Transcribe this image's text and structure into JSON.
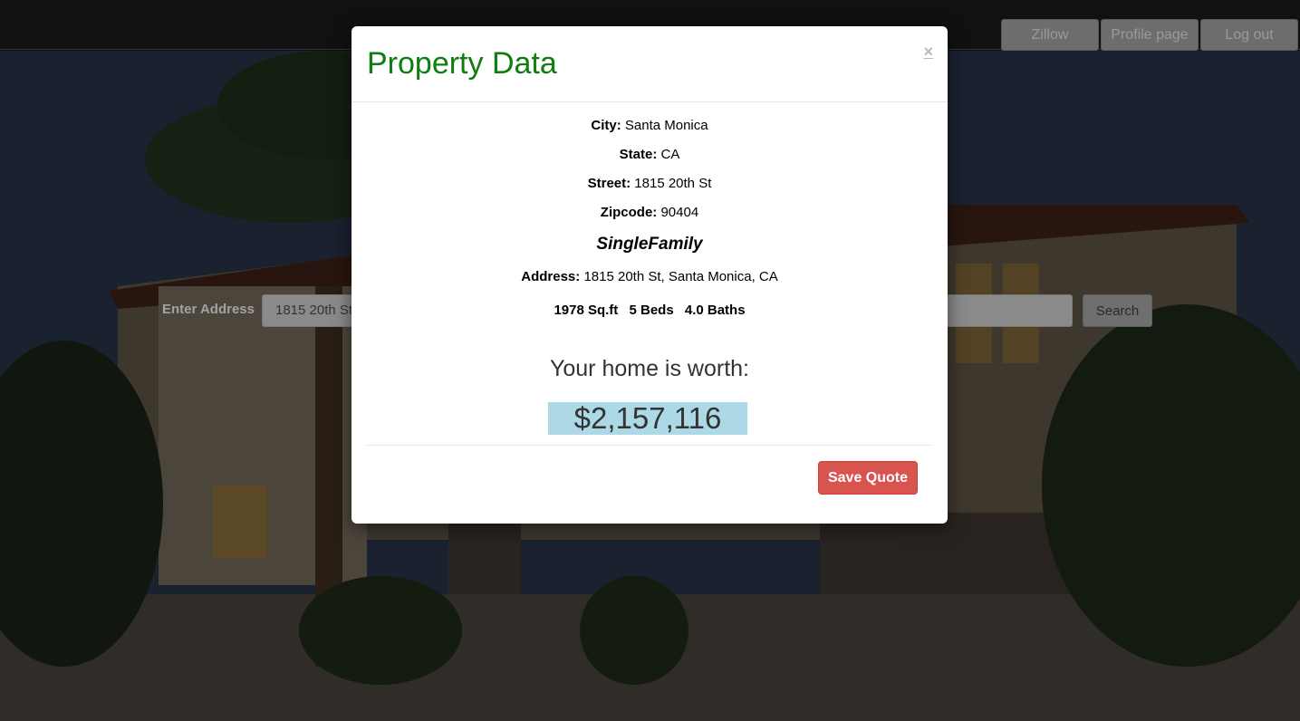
{
  "nav": {
    "zillow_label": "Zillow",
    "profile_label": "Profile page",
    "logout_label": "Log out"
  },
  "search": {
    "label": "Enter Address",
    "value": "1815 20th St",
    "button_label": "Search"
  },
  "modal": {
    "title": "Property Data",
    "close_label": "×",
    "city_label": "City:",
    "city": "Santa Monica",
    "state_label": "State:",
    "state": "CA",
    "street_label": "Street:",
    "street": "1815 20th St",
    "zipcode_label": "Zipcode:",
    "zipcode": "90404",
    "home_type": "SingleFamily",
    "address_label": "Address:",
    "address": "1815 20th St, Santa Monica, CA",
    "sqft": "1978 Sq.ft",
    "beds": "5 Beds",
    "baths": "4.0 Baths",
    "worth_label": "Your home is worth:",
    "worth_value": "$2,157,116",
    "save_label": "Save Quote"
  },
  "colors": {
    "title_green": "#0f7d0f",
    "worth_highlight": "#add8e6",
    "save_button": "#d9534f"
  }
}
